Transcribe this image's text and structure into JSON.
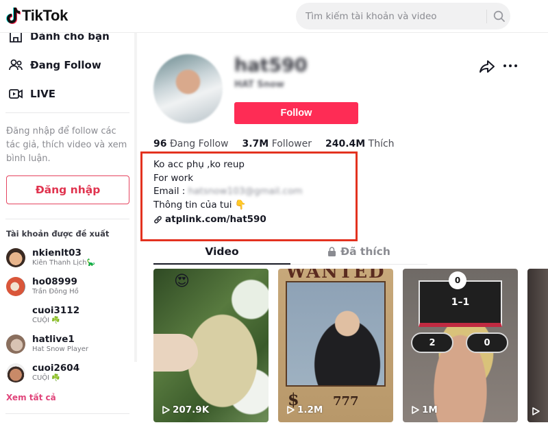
{
  "header": {
    "logo_text": "TikTok",
    "search_placeholder": "Tìm kiếm tài khoản và video"
  },
  "sidebar": {
    "nav": [
      {
        "label": "Dành cho bạn",
        "icon": "home-icon"
      },
      {
        "label": "Đang Follow",
        "icon": "following-icon"
      },
      {
        "label": "LIVE",
        "icon": "live-icon"
      }
    ],
    "login_hint": "Đăng nhập để follow các tác giả, thích video và xem bình luận.",
    "login_button": "Đăng nhập",
    "suggested_title": "Tài khoản được đề xuất",
    "suggested": [
      {
        "username": "nkienlt03",
        "nickname": "Kiên Thanh Lịch🦕"
      },
      {
        "username": "ho08999",
        "nickname": "Trần Đông Hồ"
      },
      {
        "username": "cuoi3112",
        "nickname": "CUỘI ☘️"
      },
      {
        "username": "hatlive1",
        "nickname": "Hat Snow Player"
      },
      {
        "username": "cuoi2604",
        "nickname": "CUỘI ☘️"
      }
    ],
    "see_all": "Xem tất cả"
  },
  "profile": {
    "username": "hat590",
    "nickname": "HAT Snow",
    "follow_button": "Follow",
    "stats": [
      {
        "value": "96",
        "label": "Đang Follow"
      },
      {
        "value": "3.7M",
        "label": "Follower"
      },
      {
        "value": "240.4M",
        "label": "Thích"
      }
    ],
    "bio": {
      "line1": "Ko acc phụ ,ko reup",
      "line2": "For work",
      "email_label": "Email : ",
      "email": "hatsnow103@gmail.com",
      "line4": "Thông tin của tui 👇"
    },
    "link": "atplink.com/hat590"
  },
  "tabs": [
    {
      "label": "Video",
      "active": true
    },
    {
      "label": "Đã thích",
      "locked": true
    }
  ],
  "videos": [
    {
      "views": "207.9K",
      "overlay": "😍"
    },
    {
      "views": "1.2M",
      "overlay_title": "WANTED",
      "overlay_price": "777",
      "overlay_currency": "$"
    },
    {
      "views": "1M",
      "overlay_top": "0",
      "overlay_board": "1–1",
      "overlay_left": "2",
      "overlay_right": "0"
    },
    {
      "views": ""
    }
  ],
  "colors": {
    "brand": "#fe2c55",
    "login_text": "#e0344f",
    "highlight_box": "#e3321f",
    "see_all": "#e0447a"
  }
}
